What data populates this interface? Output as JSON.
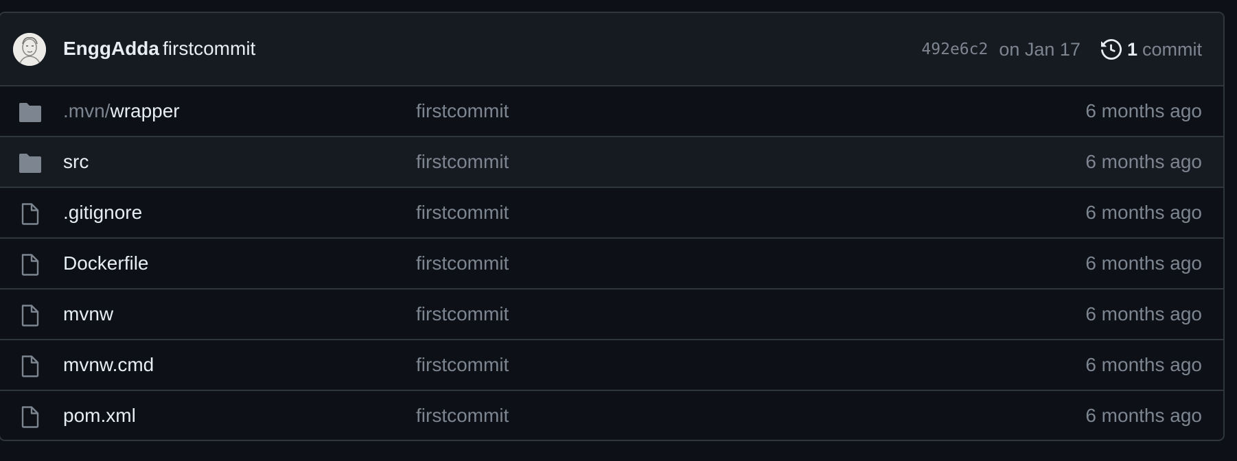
{
  "commit": {
    "author": "EnggAdda",
    "message": "firstcommit",
    "sha": "492e6c2",
    "date": "on Jan 17",
    "count": "1",
    "count_label": "commit",
    "history_icon": "history-icon",
    "avatar": "author-avatar"
  },
  "files": [
    {
      "prefix": ".mvn/",
      "name": "wrapper",
      "type": "directory",
      "icon": "folder-icon",
      "message": "firstcommit",
      "time": "6 months ago"
    },
    {
      "prefix": "",
      "name": "src",
      "type": "directory",
      "icon": "folder-icon",
      "message": "firstcommit",
      "time": "6 months ago"
    },
    {
      "prefix": "",
      "name": ".gitignore",
      "type": "file",
      "icon": "file-icon",
      "message": "firstcommit",
      "time": "6 months ago"
    },
    {
      "prefix": "",
      "name": "Dockerfile",
      "type": "file",
      "icon": "file-icon",
      "message": "firstcommit",
      "time": "6 months ago"
    },
    {
      "prefix": "",
      "name": "mvnw",
      "type": "file",
      "icon": "file-icon",
      "message": "firstcommit",
      "time": "6 months ago"
    },
    {
      "prefix": "",
      "name": "mvnw.cmd",
      "type": "file",
      "icon": "file-icon",
      "message": "firstcommit",
      "time": "6 months ago"
    },
    {
      "prefix": "",
      "name": "pom.xml",
      "type": "file",
      "icon": "file-icon",
      "message": "firstcommit",
      "time": "6 months ago"
    }
  ],
  "colors": {
    "background": "#0d1117",
    "header_background": "#161b22",
    "border": "#30363d",
    "text_primary": "#e6edf3",
    "text_muted": "#7d8590",
    "folder_icon": "#7d8590"
  }
}
